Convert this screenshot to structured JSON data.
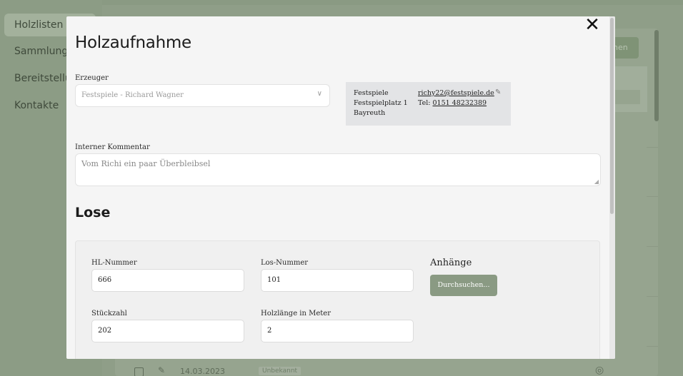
{
  "sidebar": {
    "items": [
      {
        "label": "Holzlisten"
      },
      {
        "label": "Sammlungen"
      },
      {
        "label": "Bereitstellung"
      },
      {
        "label": "Kontakte"
      }
    ]
  },
  "background": {
    "primary_button_label": "nen",
    "row": {
      "date": "14.03.2023",
      "status": "Unbekannt"
    }
  },
  "modal": {
    "close_icon": "close-icon",
    "title": "Holzaufnahme",
    "producer": {
      "label": "Erzeuger",
      "value": "Festspiele - Richard Wagner"
    },
    "contact": {
      "name": "Festspiele",
      "street": "Festspielplatz 1",
      "city": "Bayreuth",
      "email": "richy22@festspiele.de",
      "phone_prefix": "Tel: ",
      "phone": "0151 48232389"
    },
    "comment": {
      "label": "Interner Kommentar",
      "value": "Vom Richi ein paar Überbleibsel"
    },
    "lots": {
      "title": "Lose",
      "hl_number": {
        "label": "HL-Nummer",
        "value": "666"
      },
      "lot_number": {
        "label": "Los-Nummer",
        "value": "101"
      },
      "quantity": {
        "label": "Stückzahl",
        "value": "202"
      },
      "length": {
        "label": "Holzlänge in Meter",
        "value": "2"
      },
      "attachments": {
        "title": "Anhänge",
        "browse_label": "Durchsuchen..."
      }
    }
  }
}
